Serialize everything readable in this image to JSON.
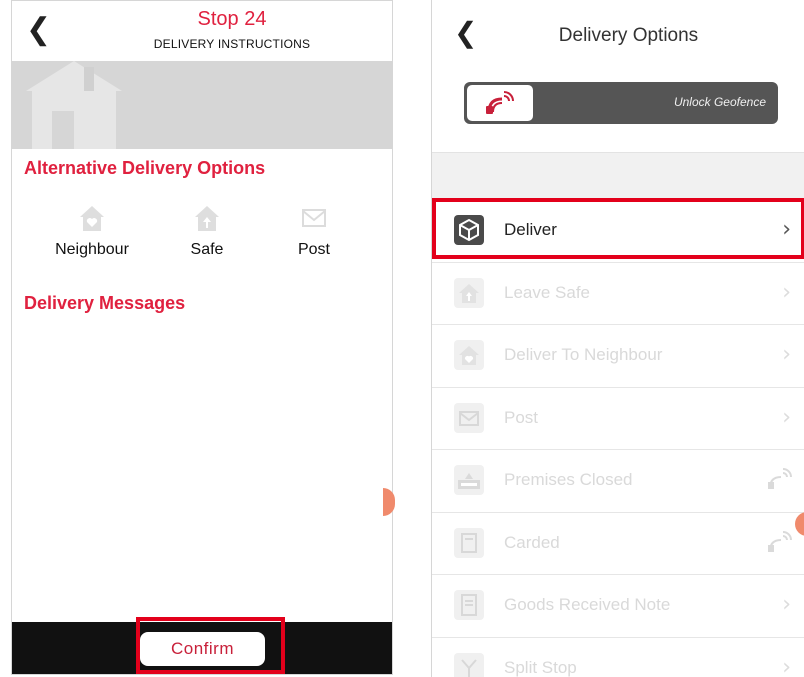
{
  "left_screen": {
    "stop_title": "Stop 24",
    "subtitle": "DELIVERY INSTRUCTIONS",
    "alt_options_title": "Alternative Delivery Options",
    "options": [
      {
        "label": "Neighbour",
        "icon": "house-heart-icon"
      },
      {
        "label": "Safe",
        "icon": "house-arrow-icon"
      },
      {
        "label": "Post",
        "icon": "envelope-icon"
      }
    ],
    "messages_title": "Delivery Messages",
    "confirm_label": "Confirm"
  },
  "right_screen": {
    "title": "Delivery Options",
    "geofence_label": "Unlock Geofence",
    "items": [
      {
        "label": "Deliver",
        "icon": "package-icon",
        "trail": "chevron"
      },
      {
        "label": "Leave Safe",
        "icon": "house-arrow-icon",
        "trail": "chevron"
      },
      {
        "label": "Deliver To Neighbour",
        "icon": "house-heart-icon",
        "trail": "chevron"
      },
      {
        "label": "Post",
        "icon": "envelope-icon",
        "trail": "chevron"
      },
      {
        "label": "Premises Closed",
        "icon": "closed-sign-icon",
        "trail": "satellite"
      },
      {
        "label": "Carded",
        "icon": "card-icon",
        "trail": "satellite"
      },
      {
        "label": "Goods Received Note",
        "icon": "note-icon",
        "trail": "chevron"
      },
      {
        "label": "Split Stop",
        "icon": "split-icon",
        "trail": "chevron"
      }
    ]
  },
  "colors": {
    "brand_red": "#e0213f",
    "highlight_red": "#e3001b",
    "toggle_gray": "#555555"
  }
}
